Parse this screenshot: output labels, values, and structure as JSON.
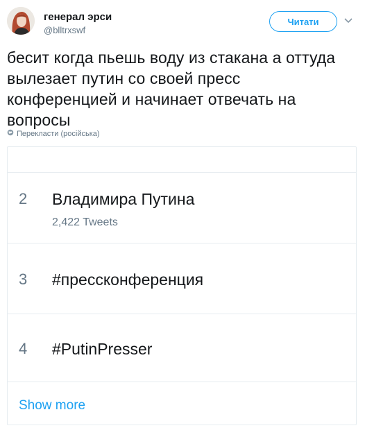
{
  "tweet": {
    "author_name": "генерал эрси",
    "author_handle": "@blltrxswf",
    "follow_label": "Читати",
    "text": "бесит когда пьешь воду из стакана а оттуда вылезает путин со своей пресс конференцией и начинает отвечать на вопросы",
    "translate_label": "Перекласти (російська)"
  },
  "trends": {
    "items": [
      {
        "rank": "2",
        "topic": "Владимира Путина",
        "count": "2,422 Tweets"
      },
      {
        "rank": "3",
        "topic": "#прессконференция",
        "count": ""
      },
      {
        "rank": "4",
        "topic": "#PutinPresser",
        "count": ""
      }
    ],
    "show_more_label": "Show more"
  },
  "colors": {
    "accent": "#1da1f2",
    "text": "#14171a",
    "muted": "#657786",
    "border": "#e6ecf0"
  },
  "icons": [
    "avatar",
    "chevron-down-icon",
    "globe-icon"
  ]
}
